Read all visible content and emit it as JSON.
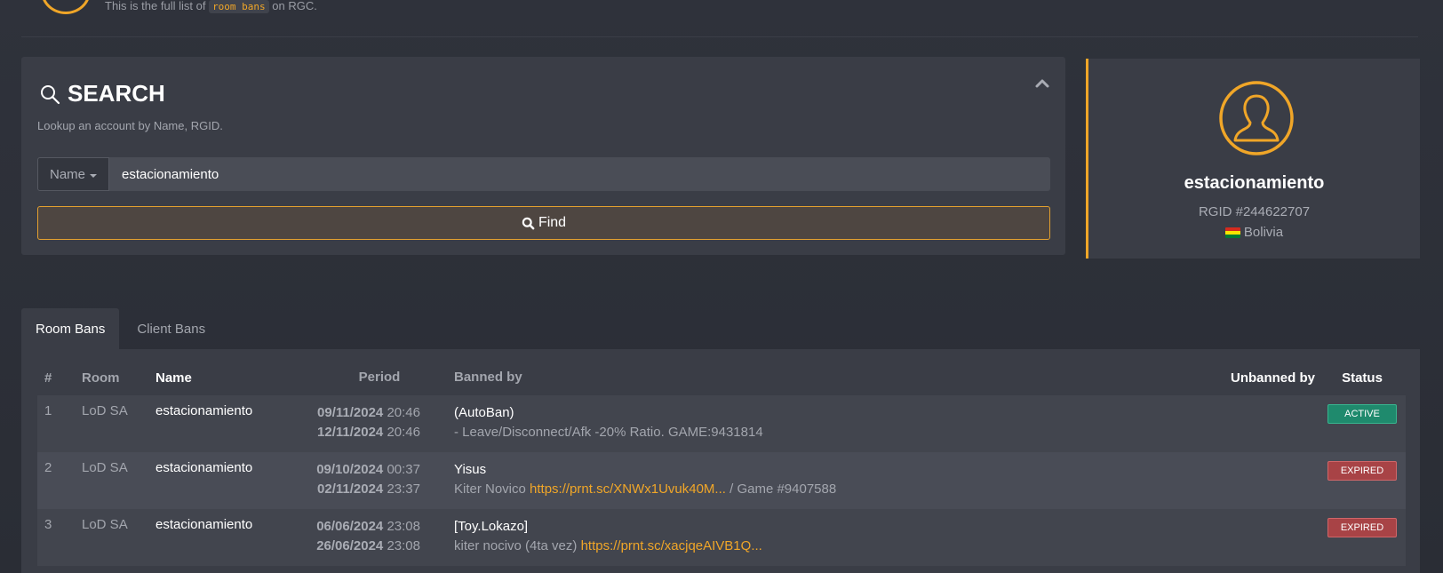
{
  "intro": {
    "prefix": "This is the full list of",
    "code": "room bans",
    "suffix": "on RGC."
  },
  "search": {
    "title": "SEARCH",
    "subtitle": "Lookup an account by Name, RGID.",
    "type_selected": "Name",
    "query": "estacionamiento",
    "find_label": "Find"
  },
  "profile": {
    "name": "estacionamiento",
    "rgid": "RGID #244622707",
    "country": "Bolivia"
  },
  "tabs": [
    {
      "label": "Room Bans",
      "active": true
    },
    {
      "label": "Client Bans",
      "active": false
    }
  ],
  "table": {
    "headers": {
      "num": "#",
      "room": "Room",
      "name": "Name",
      "period": "Period",
      "banned_by": "Banned by",
      "unbanned_by": "Unbanned by",
      "status": "Status"
    },
    "rows": [
      {
        "num": "1",
        "room": "LoD SA",
        "name": "estacionamiento",
        "start_date": "09/11/2024",
        "start_time": "20:46",
        "end_date": "12/11/2024",
        "end_time": "20:46",
        "banned_by": "(AutoBan)",
        "reason": "- Leave/Disconnect/Afk -20% Ratio. GAME:9431814",
        "link": "",
        "reason_suffix": "",
        "unbanned_by": "",
        "status": "ACTIVE"
      },
      {
        "num": "2",
        "room": "LoD SA",
        "name": "estacionamiento",
        "start_date": "09/10/2024",
        "start_time": "00:37",
        "end_date": "02/11/2024",
        "end_time": "23:37",
        "banned_by": "Yisus",
        "reason": "Kiter Novico",
        "link": "https://prnt.sc/XNWx1Uvuk40M...",
        "reason_suffix": "/ Game #9407588",
        "unbanned_by": "",
        "status": "EXPIRED"
      },
      {
        "num": "3",
        "room": "LoD SA",
        "name": "estacionamiento",
        "start_date": "06/06/2024",
        "start_time": "23:08",
        "end_date": "26/06/2024",
        "end_time": "23:08",
        "banned_by": "[Toy.Lokazo]",
        "reason": "kiter nocivo (4ta vez)",
        "link": "https://prnt.sc/xacjqeAIVB1Q...",
        "reason_suffix": "",
        "unbanned_by": "",
        "status": "EXPIRED"
      }
    ]
  },
  "colors": {
    "accent": "#f0a628",
    "active": "#1f8a6d",
    "expired": "#a84346"
  }
}
